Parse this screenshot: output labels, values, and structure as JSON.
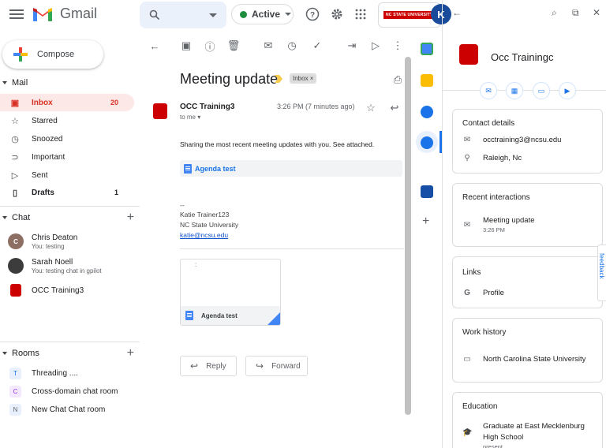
{
  "app": {
    "name": "Gmail",
    "search_placeholder": "",
    "status": "Active",
    "account_initial": "K",
    "org_badge": "NC STATE UNIVERSITY"
  },
  "compose": {
    "label": "Compose"
  },
  "nav": {
    "mail_header": "Mail",
    "items": [
      {
        "label": "Inbox",
        "count": "20",
        "icon": "inbox-icon"
      },
      {
        "label": "Starred",
        "count": "",
        "icon": "star-icon"
      },
      {
        "label": "Snoozed",
        "count": "",
        "icon": "clock-icon"
      },
      {
        "label": "Important",
        "count": "",
        "icon": "important-icon"
      },
      {
        "label": "Sent",
        "count": "",
        "icon": "send-icon"
      },
      {
        "label": "Drafts",
        "count": "1",
        "icon": "draft-icon"
      }
    ],
    "chat_header": "Chat",
    "chats": [
      {
        "name": "Chris Deaton",
        "sub": "You: testing",
        "initial": "C"
      },
      {
        "name": "Sarah Noell",
        "sub": "You: testing chat in gpilot",
        "initial": ""
      },
      {
        "name": "OCC Training3",
        "sub": "",
        "initial": ""
      }
    ],
    "rooms_header": "Rooms",
    "rooms": [
      {
        "name": "Threading ....",
        "badge": "T"
      },
      {
        "name": "Cross-domain chat room",
        "badge": "C"
      },
      {
        "name": "New Chat Chat room",
        "badge": "N"
      }
    ]
  },
  "email": {
    "subject": "Meeting update",
    "label": "Inbox ×",
    "sender": "OCC Training3",
    "to": "to me",
    "time": "3:26 PM (7 minutes ago)",
    "body": "Sharing the most recent meeting updates with you.  See attached.",
    "attachment_link": "Agenda test",
    "sig_dash": "--",
    "sig_name": "Katie Trainer123",
    "sig_org": "NC State University",
    "sig_email": "katie@ncsu.edu",
    "attachment_card": "Agenda test",
    "card_dots": ":",
    "reply": "Reply",
    "forward": "Forward"
  },
  "contact": {
    "name": "Occ Trainingc",
    "details_title": "Contact details",
    "email": "occtraining3@ncsu.edu",
    "location": "Raleigh, Nc",
    "interactions_title": "Recent interactions",
    "interaction_subject": "Meeting update",
    "interaction_time": "3:26 PM",
    "links_title": "Links",
    "link_profile": "Profile",
    "work_title": "Work history",
    "work_org": "North Carolina State University",
    "edu_title": "Education",
    "edu_line1": "Graduate at East Mecklenburg",
    "edu_line2": "High School",
    "edu_sub": "present",
    "feedback": "feedback"
  },
  "colors": {
    "accent_red": "#d93025",
    "active_green": "#1e8e3e",
    "link_blue": "#1a73e8",
    "ncsu_red": "#cc0000"
  }
}
